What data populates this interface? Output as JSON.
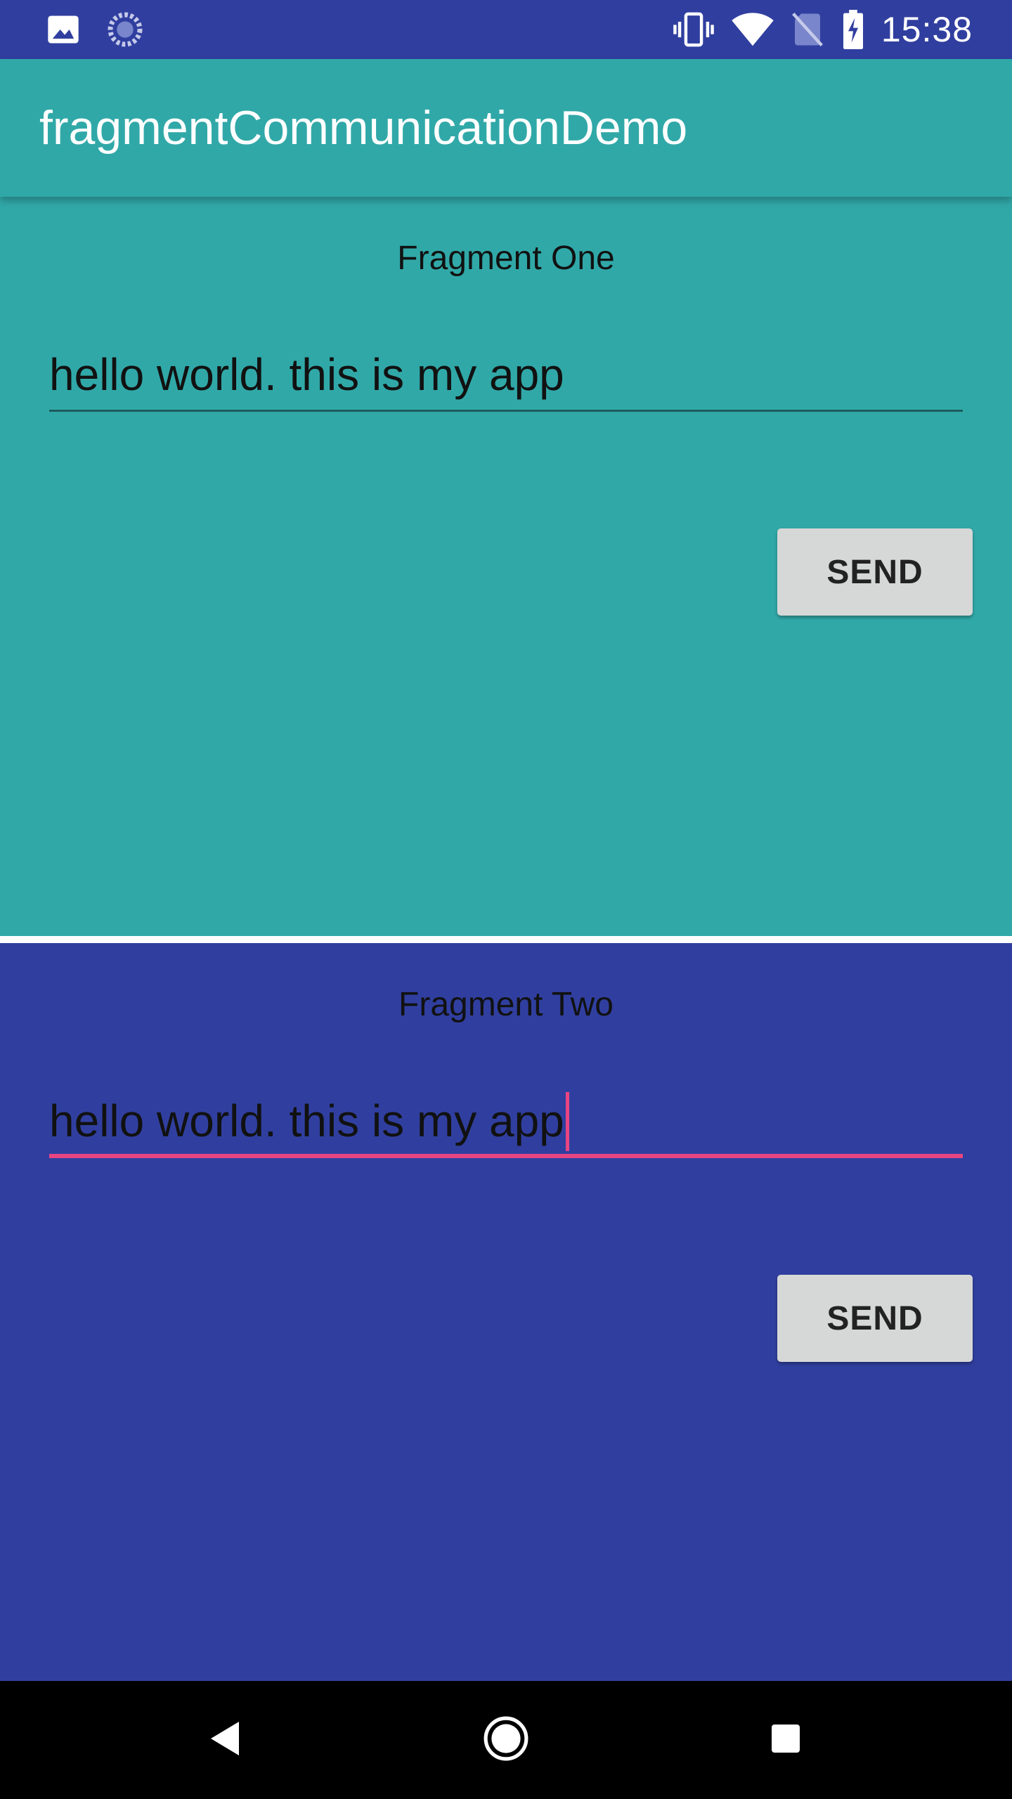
{
  "status_bar": {
    "time": "15:38",
    "left_icons": [
      "image-notification-icon",
      "sync-progress-icon"
    ],
    "right_icons": [
      "vibrate-icon",
      "wifi-icon",
      "no-sim-icon",
      "battery-charging-icon"
    ]
  },
  "app_bar": {
    "title": "fragmentCommunicationDemo"
  },
  "fragment_one": {
    "title": "Fragment One",
    "input_value": "hello world. this is my app",
    "send_label": "SEND",
    "background": "#31a8a8"
  },
  "fragment_two": {
    "title": "Fragment Two",
    "input_value": "hello world. this is my app",
    "send_label": "SEND",
    "background": "#303f9f",
    "focused": true
  },
  "nav_bar": {
    "icons": [
      "back-icon",
      "home-icon",
      "recents-icon"
    ]
  },
  "colors": {
    "primary": "#31a8a8",
    "primary_dark": "#303f9f",
    "accent": "#e94583"
  }
}
